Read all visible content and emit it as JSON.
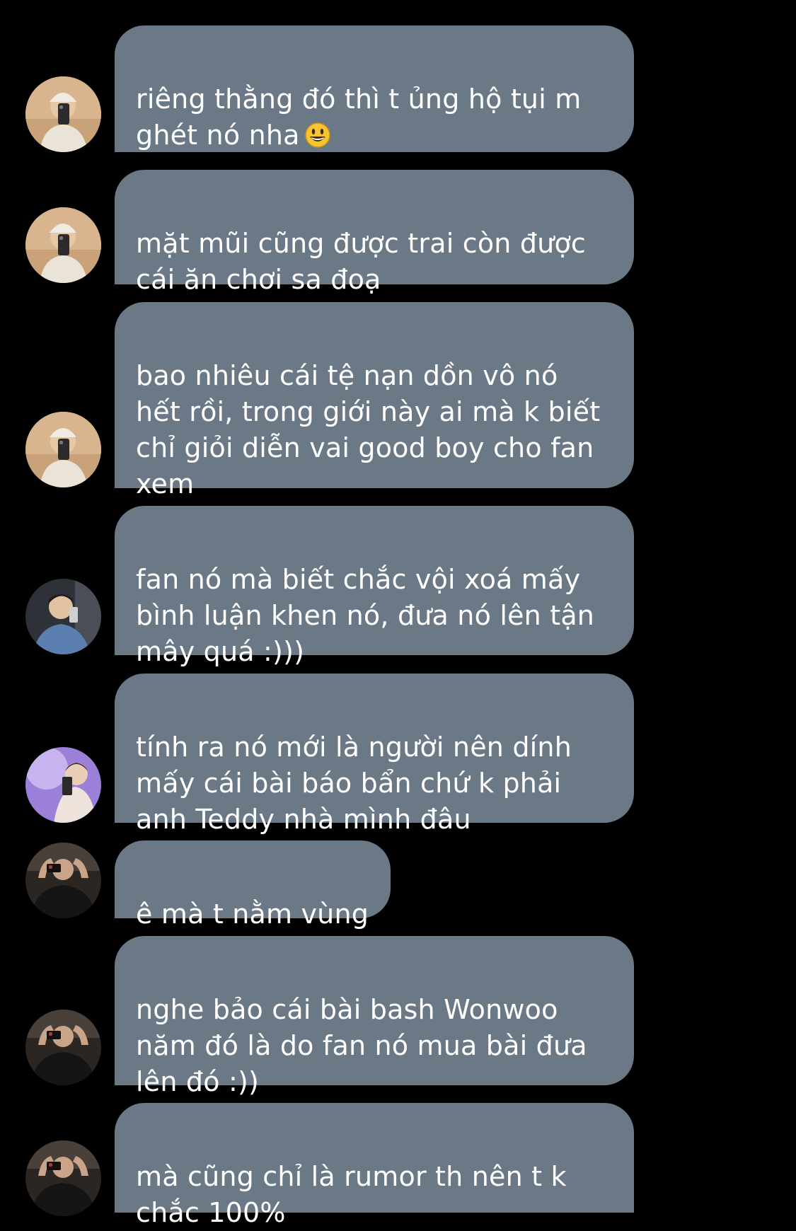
{
  "messages": [
    {
      "text": "riêng thằng đó thì t ủng hộ tụi m\nghét nó nha",
      "emoji": "grinning-face-emoji",
      "avatar": "avatar-user-a"
    },
    {
      "text": "mặt mũi cũng được trai còn được\ncái ăn chơi sa đoạ",
      "avatar": "avatar-user-a"
    },
    {
      "text": "bao nhiêu cái tệ nạn dồn vô nó\nhết rồi, trong giới này ai mà k biết\nchỉ giỏi diễn vai good boy cho fan\nxem",
      "avatar": "avatar-user-a"
    },
    {
      "text": "fan nó mà biết chắc vội xoá mấy\nbình luận khen nó, đưa nó lên tận\nmây quá :)))",
      "avatar": "avatar-user-b"
    },
    {
      "text": "tính ra nó mới là người nên dính\nmấy cái bài báo bẩn chứ k phải\nanh Teddy nhà mình đâu",
      "avatar": "avatar-user-c"
    },
    {
      "text": "ê mà t nằm vùng",
      "avatar": "avatar-user-d"
    },
    {
      "text": "nghe bảo cái bài bash Wonwoo\nnăm đó là do fan nó mua bài đưa\nlên đó :))",
      "avatar": "avatar-user-d"
    },
    {
      "text": "mà cũng chỉ là rumor th nên t k\nchắc 100%",
      "avatar": "avatar-user-d"
    }
  ],
  "colors": {
    "background": "#000000",
    "bubble": "#6b7885",
    "text": "#ffffff"
  }
}
